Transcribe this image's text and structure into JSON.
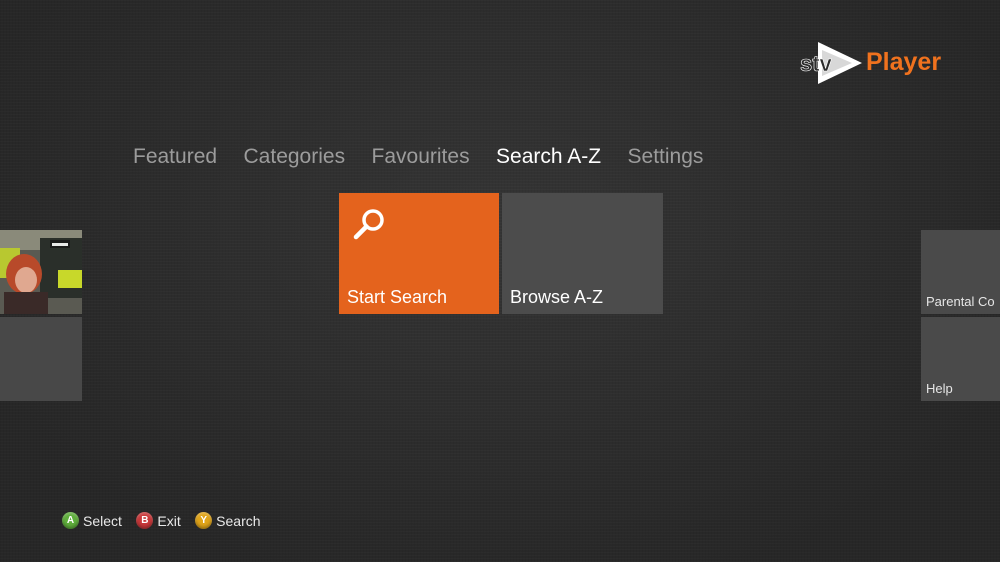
{
  "brand": {
    "logo_mark": "stv",
    "logo_text": "Player",
    "accent_color": "#f0721e"
  },
  "nav": {
    "items": [
      {
        "label": "Featured",
        "active": false
      },
      {
        "label": "Categories",
        "active": false
      },
      {
        "label": "Favourites",
        "active": false
      },
      {
        "label": "Search A-Z",
        "active": true
      },
      {
        "label": "Settings",
        "active": false
      }
    ]
  },
  "tiles": {
    "start_search": {
      "label": "Start Search",
      "icon": "search-icon",
      "color": "#e4631d"
    },
    "browse_az": {
      "label": "Browse A-Z",
      "color": "#4c4c4c"
    },
    "left_thumbnail": {
      "icon": "programme-thumbnail"
    },
    "right": [
      {
        "label": "Parental Co"
      },
      {
        "label": "Help"
      }
    ]
  },
  "hints": [
    {
      "button": "A",
      "label": "Select",
      "color": "#5fae3c"
    },
    {
      "button": "B",
      "label": "Exit",
      "color": "#c9383a"
    },
    {
      "button": "Y",
      "label": "Search",
      "color": "#e0a419"
    }
  ]
}
